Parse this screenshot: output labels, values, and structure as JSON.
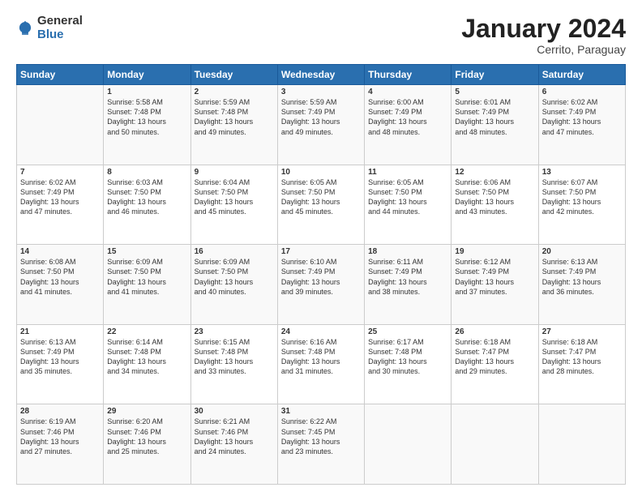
{
  "header": {
    "logo_general": "General",
    "logo_blue": "Blue",
    "main_title": "January 2024",
    "subtitle": "Cerrito, Paraguay"
  },
  "calendar": {
    "days_of_week": [
      "Sunday",
      "Monday",
      "Tuesday",
      "Wednesday",
      "Thursday",
      "Friday",
      "Saturday"
    ],
    "weeks": [
      [
        {
          "day": "",
          "info": ""
        },
        {
          "day": "1",
          "info": "Sunrise: 5:58 AM\nSunset: 7:48 PM\nDaylight: 13 hours\nand 50 minutes."
        },
        {
          "day": "2",
          "info": "Sunrise: 5:59 AM\nSunset: 7:48 PM\nDaylight: 13 hours\nand 49 minutes."
        },
        {
          "day": "3",
          "info": "Sunrise: 5:59 AM\nSunset: 7:49 PM\nDaylight: 13 hours\nand 49 minutes."
        },
        {
          "day": "4",
          "info": "Sunrise: 6:00 AM\nSunset: 7:49 PM\nDaylight: 13 hours\nand 48 minutes."
        },
        {
          "day": "5",
          "info": "Sunrise: 6:01 AM\nSunset: 7:49 PM\nDaylight: 13 hours\nand 48 minutes."
        },
        {
          "day": "6",
          "info": "Sunrise: 6:02 AM\nSunset: 7:49 PM\nDaylight: 13 hours\nand 47 minutes."
        }
      ],
      [
        {
          "day": "7",
          "info": "Sunrise: 6:02 AM\nSunset: 7:49 PM\nDaylight: 13 hours\nand 47 minutes."
        },
        {
          "day": "8",
          "info": "Sunrise: 6:03 AM\nSunset: 7:50 PM\nDaylight: 13 hours\nand 46 minutes."
        },
        {
          "day": "9",
          "info": "Sunrise: 6:04 AM\nSunset: 7:50 PM\nDaylight: 13 hours\nand 45 minutes."
        },
        {
          "day": "10",
          "info": "Sunrise: 6:05 AM\nSunset: 7:50 PM\nDaylight: 13 hours\nand 45 minutes."
        },
        {
          "day": "11",
          "info": "Sunrise: 6:05 AM\nSunset: 7:50 PM\nDaylight: 13 hours\nand 44 minutes."
        },
        {
          "day": "12",
          "info": "Sunrise: 6:06 AM\nSunset: 7:50 PM\nDaylight: 13 hours\nand 43 minutes."
        },
        {
          "day": "13",
          "info": "Sunrise: 6:07 AM\nSunset: 7:50 PM\nDaylight: 13 hours\nand 42 minutes."
        }
      ],
      [
        {
          "day": "14",
          "info": "Sunrise: 6:08 AM\nSunset: 7:50 PM\nDaylight: 13 hours\nand 41 minutes."
        },
        {
          "day": "15",
          "info": "Sunrise: 6:09 AM\nSunset: 7:50 PM\nDaylight: 13 hours\nand 41 minutes."
        },
        {
          "day": "16",
          "info": "Sunrise: 6:09 AM\nSunset: 7:50 PM\nDaylight: 13 hours\nand 40 minutes."
        },
        {
          "day": "17",
          "info": "Sunrise: 6:10 AM\nSunset: 7:49 PM\nDaylight: 13 hours\nand 39 minutes."
        },
        {
          "day": "18",
          "info": "Sunrise: 6:11 AM\nSunset: 7:49 PM\nDaylight: 13 hours\nand 38 minutes."
        },
        {
          "day": "19",
          "info": "Sunrise: 6:12 AM\nSunset: 7:49 PM\nDaylight: 13 hours\nand 37 minutes."
        },
        {
          "day": "20",
          "info": "Sunrise: 6:13 AM\nSunset: 7:49 PM\nDaylight: 13 hours\nand 36 minutes."
        }
      ],
      [
        {
          "day": "21",
          "info": "Sunrise: 6:13 AM\nSunset: 7:49 PM\nDaylight: 13 hours\nand 35 minutes."
        },
        {
          "day": "22",
          "info": "Sunrise: 6:14 AM\nSunset: 7:48 PM\nDaylight: 13 hours\nand 34 minutes."
        },
        {
          "day": "23",
          "info": "Sunrise: 6:15 AM\nSunset: 7:48 PM\nDaylight: 13 hours\nand 33 minutes."
        },
        {
          "day": "24",
          "info": "Sunrise: 6:16 AM\nSunset: 7:48 PM\nDaylight: 13 hours\nand 31 minutes."
        },
        {
          "day": "25",
          "info": "Sunrise: 6:17 AM\nSunset: 7:48 PM\nDaylight: 13 hours\nand 30 minutes."
        },
        {
          "day": "26",
          "info": "Sunrise: 6:18 AM\nSunset: 7:47 PM\nDaylight: 13 hours\nand 29 minutes."
        },
        {
          "day": "27",
          "info": "Sunrise: 6:18 AM\nSunset: 7:47 PM\nDaylight: 13 hours\nand 28 minutes."
        }
      ],
      [
        {
          "day": "28",
          "info": "Sunrise: 6:19 AM\nSunset: 7:46 PM\nDaylight: 13 hours\nand 27 minutes."
        },
        {
          "day": "29",
          "info": "Sunrise: 6:20 AM\nSunset: 7:46 PM\nDaylight: 13 hours\nand 25 minutes."
        },
        {
          "day": "30",
          "info": "Sunrise: 6:21 AM\nSunset: 7:46 PM\nDaylight: 13 hours\nand 24 minutes."
        },
        {
          "day": "31",
          "info": "Sunrise: 6:22 AM\nSunset: 7:45 PM\nDaylight: 13 hours\nand 23 minutes."
        },
        {
          "day": "",
          "info": ""
        },
        {
          "day": "",
          "info": ""
        },
        {
          "day": "",
          "info": ""
        }
      ]
    ]
  }
}
